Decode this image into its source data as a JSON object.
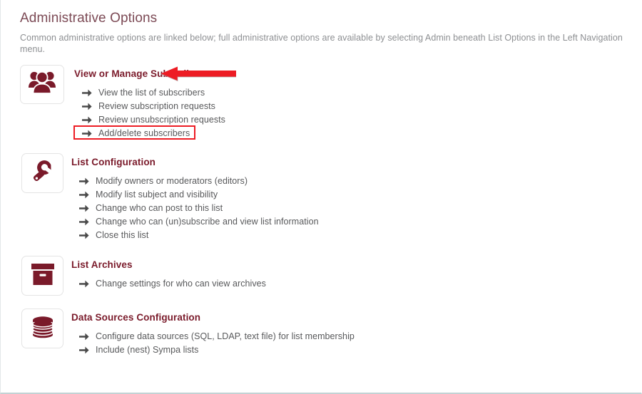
{
  "page": {
    "title": "Administrative Options",
    "description": "Common administrative options are linked below; full administrative options are available by selecting Admin beneath List Options in the Left Navigation menu."
  },
  "colors": {
    "title": "#7c4a55",
    "section_heading": "#7a1a2a",
    "icon": "#7a1a2a",
    "link_text": "#58595b",
    "description": "#8d8f92",
    "annotation_red": "#ed1c24",
    "icon_box_border": "#e4e4e4"
  },
  "annotations": {
    "callout_arrow": {
      "icon": "left-arrow-annotation-icon",
      "points_to": "View or Manage Subscribers"
    },
    "highlight_box": {
      "icon": "red-rectangle-highlight",
      "surrounds": "Add/delete subscribers"
    }
  },
  "sections": [
    {
      "id": "subscribers",
      "icon": "users-group-icon",
      "heading": "View or Manage Subscribers",
      "links": [
        {
          "label": "View the list of subscribers",
          "icon": "arrow-right-icon",
          "highlighted": false
        },
        {
          "label": "Review subscription requests",
          "icon": "arrow-right-icon",
          "highlighted": false
        },
        {
          "label": "Review unsubscription requests",
          "icon": "arrow-right-icon",
          "highlighted": false
        },
        {
          "label": "Add/delete subscribers",
          "icon": "arrow-right-icon",
          "highlighted": true
        }
      ]
    },
    {
      "id": "list-configuration",
      "icon": "wrench-icon",
      "heading": "List Configuration",
      "links": [
        {
          "label": "Modify owners or moderators (editors)",
          "icon": "arrow-right-icon",
          "highlighted": false
        },
        {
          "label": "Modify list subject and visibility",
          "icon": "arrow-right-icon",
          "highlighted": false
        },
        {
          "label": "Change who can post to this list",
          "icon": "arrow-right-icon",
          "highlighted": false
        },
        {
          "label": "Change who can (un)subscribe and view list information",
          "icon": "arrow-right-icon",
          "highlighted": false
        },
        {
          "label": "Close this list",
          "icon": "arrow-right-icon",
          "highlighted": false
        }
      ]
    },
    {
      "id": "list-archives",
      "icon": "archive-box-icon",
      "heading": "List Archives",
      "links": [
        {
          "label": "Change settings for who can view archives",
          "icon": "arrow-right-icon",
          "highlighted": false
        }
      ]
    },
    {
      "id": "data-sources-configuration",
      "icon": "database-stack-icon",
      "heading": "Data Sources Configuration",
      "links": [
        {
          "label": "Configure data sources (SQL, LDAP, text file) for list membership",
          "icon": "arrow-right-icon",
          "highlighted": false
        },
        {
          "label": "Include (nest) Sympa lists",
          "icon": "arrow-right-icon",
          "highlighted": false
        }
      ]
    }
  ]
}
